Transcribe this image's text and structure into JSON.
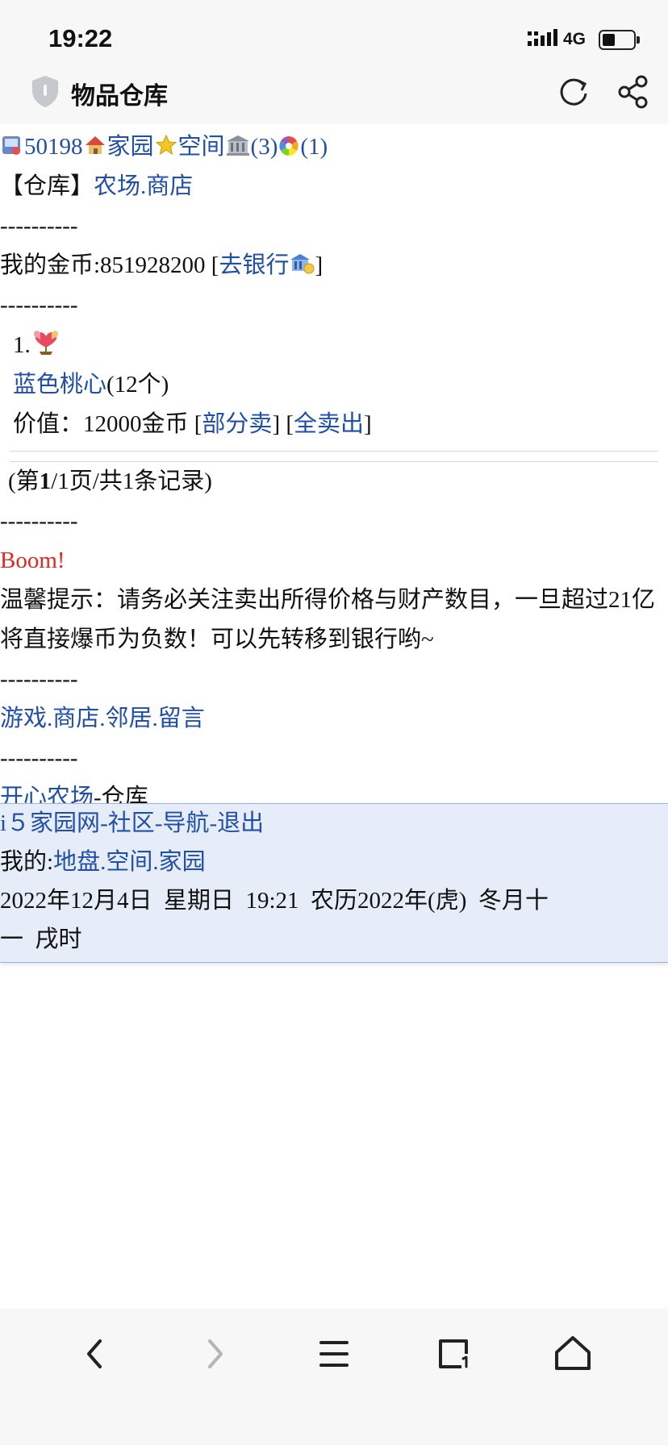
{
  "status_bar": {
    "time": "19:22",
    "network": "4G"
  },
  "browser": {
    "page_title": "物品仓库"
  },
  "top_links": {
    "user_id": "50198",
    "home": "家园",
    "space": "空间",
    "count_a": "(3)",
    "count_b": "(1)"
  },
  "warehouse_line": {
    "bracket": "【仓库】",
    "farm": "农场",
    "dot": ".",
    "shop": "商店"
  },
  "divider": "----------",
  "gold": {
    "label": "我的金币:851928200 [",
    "bank": "去银行",
    "close": "]"
  },
  "item": {
    "index": "1.",
    "name": "蓝色桃心",
    "qty": "(12个)",
    "value_text": "价值：12000金币 [",
    "partial": "部分卖",
    "mid": "] [",
    "sell_all": "全卖出",
    "end": "]"
  },
  "pagination": {
    "open": "(第",
    "page": "1",
    "rest": "/1页/共1条记录)"
  },
  "boom": "Boom!",
  "tip": "温馨提示：请务必关注卖出所得价格与财产数目，一旦超过21亿将直接爆币为负数！可以先转移到银行哟~",
  "nav": {
    "game": "游戏",
    "shop": "商店",
    "neighbor": "邻居",
    "message": "留言",
    "dot": "."
  },
  "farm_line": {
    "farm": "开心农场",
    "suffix": "-仓库"
  },
  "footer": {
    "site": "i５家园网",
    "dash": "-",
    "community": "社区",
    "nav": "导航",
    "logout": "退出",
    "mine_label": "我的:",
    "land": "地盘",
    "space": "空间",
    "home": "家园",
    "date_line1": "2022年12月4日  星期日  19:21  农历2022年(虎)  冬月十",
    "date_line2": "一  戌时"
  },
  "toolbar": {
    "back_icon": "chevron-left",
    "forward_icon": "chevron-right",
    "menu_icon": "hamburger",
    "tabs_icon": "tabs",
    "home_icon": "home"
  }
}
